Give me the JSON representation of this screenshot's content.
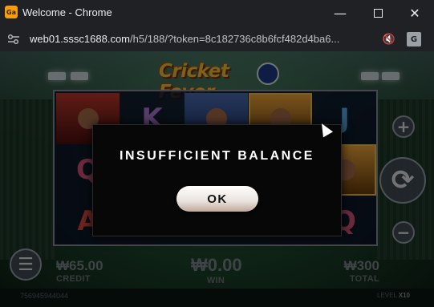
{
  "window": {
    "title": "Welcome - Chrome",
    "app_icon_text": "Ga",
    "controls": {
      "minimize": "—",
      "maximize": "",
      "close": "✕"
    }
  },
  "addressbar": {
    "url_host": "web01.sssc1688.com",
    "url_rest": "/h5/188/?token=8c182736c8b6fcf482d4ba6...",
    "site_info_icon": "tune-icon",
    "mute_icon": "🔇",
    "translate_icon": "G"
  },
  "game": {
    "logo_text": "Cricket Fever",
    "reels": {
      "symbols": [
        [
          "player-red",
          "K",
          "player-blue",
          "player-gold",
          "J"
        ],
        [
          "Q",
          "",
          "",
          "",
          "player-gold"
        ],
        [
          "A",
          "",
          "",
          "",
          "Q"
        ]
      ]
    },
    "controls": {
      "plus": "+",
      "spin": "⟳",
      "minus": "−",
      "menu": "☰"
    },
    "stats": {
      "credit_value": "₩65.00",
      "credit_label": "CREDIT",
      "win_value": "₩0.00",
      "win_label": "WIN",
      "total_value": "₩300",
      "total_label": "TOTAL"
    },
    "footer": {
      "id": "756945944044",
      "level_label": "LEVEL",
      "level_value": "X10"
    }
  },
  "modal": {
    "message": "INSUFFICIENT BALANCE",
    "ok_label": "OK"
  }
}
